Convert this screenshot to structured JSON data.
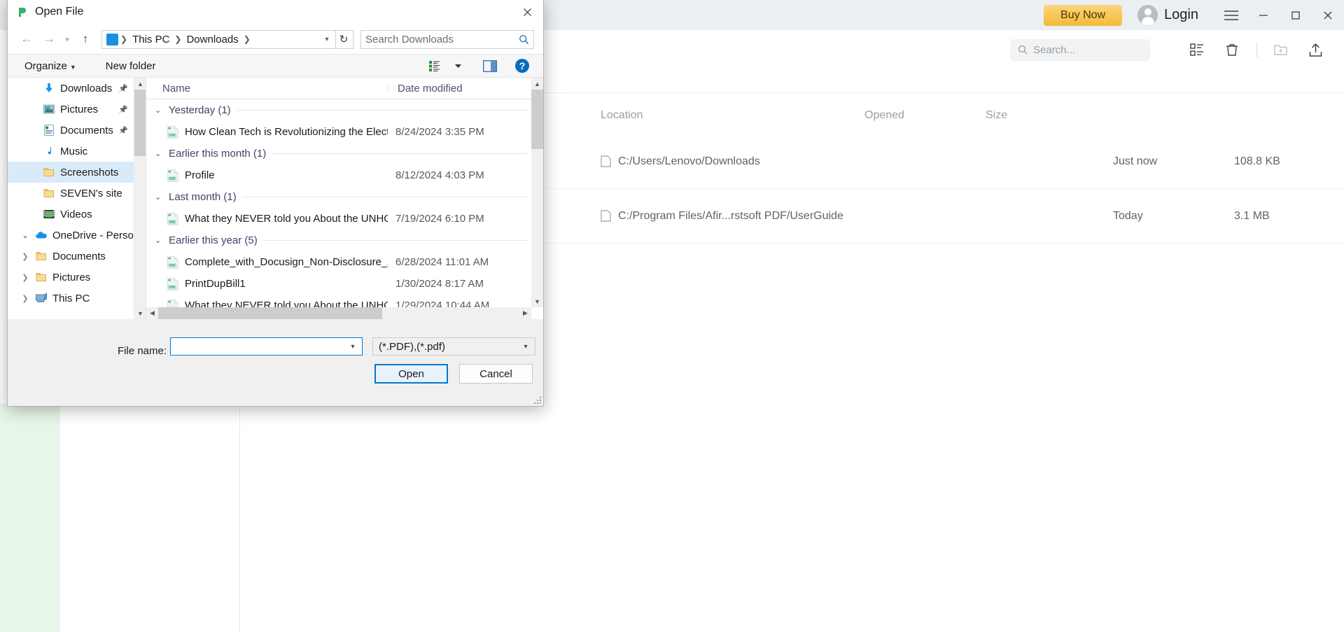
{
  "app": {
    "titlebar": {
      "buy_now_label": "Buy Now",
      "login_label": "Login",
      "menu_icon": "hamburger-icon",
      "minimize_icon": "minimize-icon",
      "maximize_icon": "maximize-icon",
      "close_icon": "close-icon"
    },
    "toolbar": {
      "search_placeholder": "Search...",
      "icons": [
        "list-view-icon",
        "trash-icon",
        "new-folder-icon",
        "upload-icon"
      ]
    },
    "list": {
      "columns": [
        "Location",
        "Opened",
        "Size"
      ],
      "rows": [
        {
          "location": "C:/Users/Lenovo/Downloads",
          "opened": "Just now",
          "size": "108.8 KB"
        },
        {
          "location": "C:/Program Files/Afir...rstsoft PDF/UserGuide",
          "opened": "Today",
          "size": "3.1 MB"
        }
      ]
    }
  },
  "dialog": {
    "title": "Open File",
    "close_icon": "close-icon",
    "nav": {
      "back_icon": "arrow-left-icon",
      "forward_icon": "arrow-right-icon",
      "recent_icon": "chevron-down-icon",
      "up_icon": "arrow-up-icon",
      "breadcrumb_icon": "downloads-arrow-icon",
      "breadcrumb": [
        "This PC",
        "Downloads"
      ],
      "breadcrumb_caret": "chevron-down-icon",
      "refresh_icon": "refresh-icon",
      "search_placeholder": "Search Downloads",
      "search_icon": "search-icon"
    },
    "commandbar": {
      "organize_label": "Organize",
      "new_folder_label": "New folder",
      "view_icon": "view-layout-icon",
      "preview_icon": "preview-pane-icon",
      "help_label": "?"
    },
    "tree": [
      {
        "label": "Downloads",
        "icon": "downloads-icon",
        "pinned": true,
        "indent": 0,
        "expander": "",
        "selected": false
      },
      {
        "label": "Pictures",
        "icon": "pictures-icon",
        "pinned": true,
        "indent": 0,
        "expander": "",
        "selected": false
      },
      {
        "label": "Documents",
        "icon": "documents-icon",
        "pinned": true,
        "indent": 0,
        "expander": "",
        "selected": false
      },
      {
        "label": "Music",
        "icon": "music-icon",
        "pinned": false,
        "indent": 0,
        "expander": "",
        "selected": false
      },
      {
        "label": "Screenshots",
        "icon": "folder-icon",
        "pinned": false,
        "indent": 0,
        "expander": "",
        "selected": true
      },
      {
        "label": "SEVEN's site",
        "icon": "folder-icon",
        "pinned": false,
        "indent": 0,
        "expander": "",
        "selected": false
      },
      {
        "label": "Videos",
        "icon": "videos-icon",
        "pinned": false,
        "indent": 0,
        "expander": "",
        "selected": false
      },
      {
        "label": "OneDrive - Person",
        "icon": "onedrive-icon",
        "pinned": false,
        "indent": -1,
        "expander": "open",
        "selected": false
      },
      {
        "label": "Documents",
        "icon": "folder-icon",
        "pinned": false,
        "indent": 1,
        "expander": "closed",
        "selected": false
      },
      {
        "label": "Pictures",
        "icon": "folder-icon",
        "pinned": false,
        "indent": 1,
        "expander": "closed",
        "selected": false
      },
      {
        "label": "This PC",
        "icon": "pc-icon",
        "pinned": false,
        "indent": -1,
        "expander": "closed",
        "selected": false
      }
    ],
    "list": {
      "columns": {
        "name": "Name",
        "date": "Date modified"
      },
      "groups": [
        {
          "label": "Yesterday (1)",
          "files": [
            {
              "name": "How Clean Tech is Revolutionizing the Electric V...",
              "date": "8/24/2024 3:35 PM"
            }
          ]
        },
        {
          "label": "Earlier this month (1)",
          "files": [
            {
              "name": "Profile",
              "date": "8/12/2024 4:03 PM"
            }
          ]
        },
        {
          "label": "Last month (1)",
          "files": [
            {
              "name": "What they NEVER told you About the UNHOLY ...",
              "date": "7/19/2024 6:10 PM"
            }
          ]
        },
        {
          "label": "Earlier this year (5)",
          "files": [
            {
              "name": "Complete_with_Docusign_Non-Disclosure_Agre...",
              "date": "6/28/2024 11:01 AM"
            },
            {
              "name": "PrintDupBill1",
              "date": "1/30/2024 8:17 AM"
            },
            {
              "name": "What they NEVER told you About the UNHOLY ...",
              "date": "1/29/2024 10:44 AM"
            }
          ]
        }
      ]
    },
    "footer": {
      "file_name_label": "File name:",
      "file_name_value": "",
      "file_name_placeholder": "",
      "filter_value": "(*.PDF),(*.pdf)",
      "open_label": "Open",
      "cancel_label": "Cancel"
    }
  }
}
